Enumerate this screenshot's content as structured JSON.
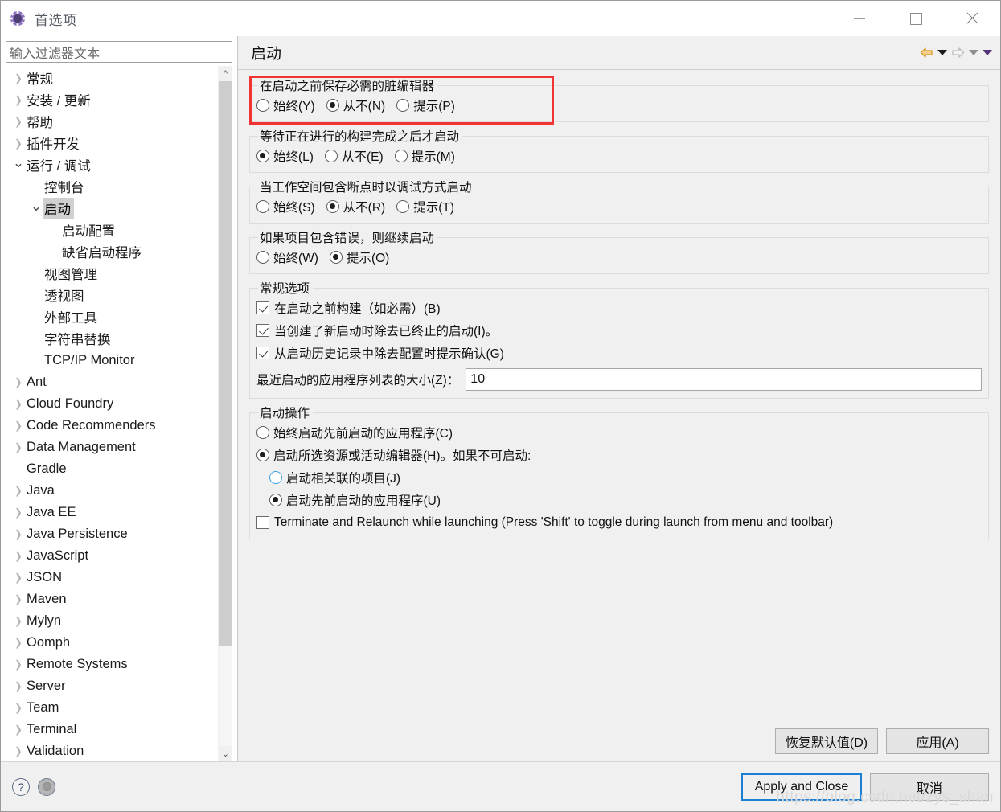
{
  "window": {
    "title": "首选项",
    "app_icon": "gear-icon",
    "controls": {
      "minimize": "minimize-icon",
      "maximize": "maximize-icon",
      "close": "close-icon"
    }
  },
  "sidebar": {
    "filter": {
      "placeholder": "输入过滤器文本",
      "value": ""
    },
    "items": [
      {
        "label": "常规",
        "depth": 0,
        "state": "collapsed",
        "selected": false
      },
      {
        "label": "安装 / 更新",
        "depth": 0,
        "state": "collapsed",
        "selected": false
      },
      {
        "label": "帮助",
        "depth": 0,
        "state": "collapsed",
        "selected": false
      },
      {
        "label": "插件开发",
        "depth": 0,
        "state": "collapsed",
        "selected": false
      },
      {
        "label": "运行 / 调试",
        "depth": 0,
        "state": "expanded",
        "selected": false
      },
      {
        "label": "控制台",
        "depth": 1,
        "state": "leaf",
        "selected": false
      },
      {
        "label": "启动",
        "depth": 1,
        "state": "expanded",
        "selected": true
      },
      {
        "label": "启动配置",
        "depth": 2,
        "state": "leaf",
        "selected": false
      },
      {
        "label": "缺省启动程序",
        "depth": 2,
        "state": "leaf",
        "selected": false
      },
      {
        "label": "视图管理",
        "depth": 1,
        "state": "leaf",
        "selected": false
      },
      {
        "label": "透视图",
        "depth": 1,
        "state": "leaf",
        "selected": false
      },
      {
        "label": "外部工具",
        "depth": 1,
        "state": "leaf",
        "selected": false
      },
      {
        "label": "字符串替换",
        "depth": 1,
        "state": "leaf",
        "selected": false
      },
      {
        "label": "TCP/IP Monitor",
        "depth": 1,
        "state": "leaf",
        "selected": false
      },
      {
        "label": "Ant",
        "depth": 0,
        "state": "collapsed",
        "selected": false
      },
      {
        "label": "Cloud Foundry",
        "depth": 0,
        "state": "collapsed",
        "selected": false
      },
      {
        "label": "Code Recommenders",
        "depth": 0,
        "state": "collapsed",
        "selected": false
      },
      {
        "label": "Data Management",
        "depth": 0,
        "state": "collapsed",
        "selected": false
      },
      {
        "label": "Gradle",
        "depth": 0,
        "state": "leaf",
        "selected": false
      },
      {
        "label": "Java",
        "depth": 0,
        "state": "collapsed",
        "selected": false
      },
      {
        "label": "Java EE",
        "depth": 0,
        "state": "collapsed",
        "selected": false
      },
      {
        "label": "Java Persistence",
        "depth": 0,
        "state": "collapsed",
        "selected": false
      },
      {
        "label": "JavaScript",
        "depth": 0,
        "state": "collapsed",
        "selected": false
      },
      {
        "label": "JSON",
        "depth": 0,
        "state": "collapsed",
        "selected": false
      },
      {
        "label": "Maven",
        "depth": 0,
        "state": "collapsed",
        "selected": false
      },
      {
        "label": "Mylyn",
        "depth": 0,
        "state": "collapsed",
        "selected": false
      },
      {
        "label": "Oomph",
        "depth": 0,
        "state": "collapsed",
        "selected": false
      },
      {
        "label": "Remote Systems",
        "depth": 0,
        "state": "collapsed",
        "selected": false
      },
      {
        "label": "Server",
        "depth": 0,
        "state": "collapsed",
        "selected": false
      },
      {
        "label": "Team",
        "depth": 0,
        "state": "collapsed",
        "selected": false
      },
      {
        "label": "Terminal",
        "depth": 0,
        "state": "collapsed",
        "selected": false
      },
      {
        "label": "Validation",
        "depth": 0,
        "state": "collapsed",
        "selected": false
      }
    ],
    "scrollbar": {
      "up": "chevron-up-icon",
      "down": "chevron-down-icon"
    }
  },
  "page": {
    "title": "启动",
    "nav": {
      "back": "back-arrow-icon",
      "back_menu": "chevron-down-icon",
      "forward": "forward-arrow-icon",
      "forward_menu": "chevron-down-icon",
      "view_menu": "chevron-down-icon"
    },
    "groups": [
      {
        "id": "save-dirty-editors",
        "legend": "在启动之前保存必需的脏编辑器",
        "highlighted": true,
        "options": [
          {
            "label": "始终(Y)",
            "checked": false
          },
          {
            "label": "从不(N)",
            "checked": true
          },
          {
            "label": "提示(P)",
            "checked": false
          }
        ]
      },
      {
        "id": "wait-for-build",
        "legend": "等待正在进行的构建完成之后才启动",
        "highlighted": false,
        "options": [
          {
            "label": "始终(L)",
            "checked": true
          },
          {
            "label": "从不(E)",
            "checked": false
          },
          {
            "label": "提示(M)",
            "checked": false
          }
        ]
      },
      {
        "id": "launch-in-debug-when-breakpoints",
        "legend": "当工作空间包含断点时以调试方式启动",
        "highlighted": false,
        "options": [
          {
            "label": "始终(S)",
            "checked": false
          },
          {
            "label": "从不(R)",
            "checked": true
          },
          {
            "label": "提示(T)",
            "checked": false
          }
        ]
      },
      {
        "id": "continue-on-errors",
        "legend": "如果项目包含错误，则继续启动",
        "highlighted": false,
        "options": [
          {
            "label": "始终(W)",
            "checked": false
          },
          {
            "label": "提示(O)",
            "checked": true
          }
        ]
      }
    ],
    "general_options": {
      "legend": "常规选项",
      "checkboxes": [
        {
          "label": "在启动之前构建（如必需）(B)",
          "checked": true
        },
        {
          "label": "当创建了新启动时除去已终止的启动(I)。",
          "checked": true
        },
        {
          "label": "从启动历史记录中除去配置时提示确认(G)",
          "checked": true
        }
      ],
      "size_field": {
        "label": "最近启动的应用程序列表的大小(Z)：",
        "value": "10"
      }
    },
    "launch_operation": {
      "legend": "启动操作",
      "radios": [
        {
          "label": "始终启动先前启动的应用程序(C)",
          "checked": false,
          "indent": 0,
          "focus": false
        },
        {
          "label": "启动所选资源或活动编辑器(H)。如果不可启动:",
          "checked": true,
          "indent": 0,
          "focus": false
        },
        {
          "label": "启动相关联的项目(J)",
          "checked": false,
          "indent": 1,
          "focus": true
        },
        {
          "label": "启动先前启动的应用程序(U)",
          "checked": true,
          "indent": 1,
          "focus": false
        }
      ],
      "terminate_checkbox": {
        "label": "Terminate and Relaunch while launching (Press 'Shift' to toggle during launch from menu and toolbar)",
        "checked": false
      }
    },
    "page_buttons": [
      {
        "id": "restore-defaults",
        "label": "恢复默认值(D)"
      },
      {
        "id": "apply",
        "label": "应用(A)"
      }
    ]
  },
  "footer": {
    "help_icon": "help-icon",
    "status_icon": "status-circle-icon",
    "buttons": [
      {
        "id": "apply-and-close",
        "label": "Apply and Close",
        "primary": true
      },
      {
        "id": "cancel",
        "label": "取消",
        "primary": false
      }
    ]
  },
  "watermark": "https://blog.csdn.net/zys_shan",
  "colors": {
    "accent_focus": "#1b7fd4",
    "highlight_box": "#f03434",
    "selection": "#d0d0d0",
    "panel_bg": "#f0f0f0",
    "nav_back": "#e8a33d"
  }
}
